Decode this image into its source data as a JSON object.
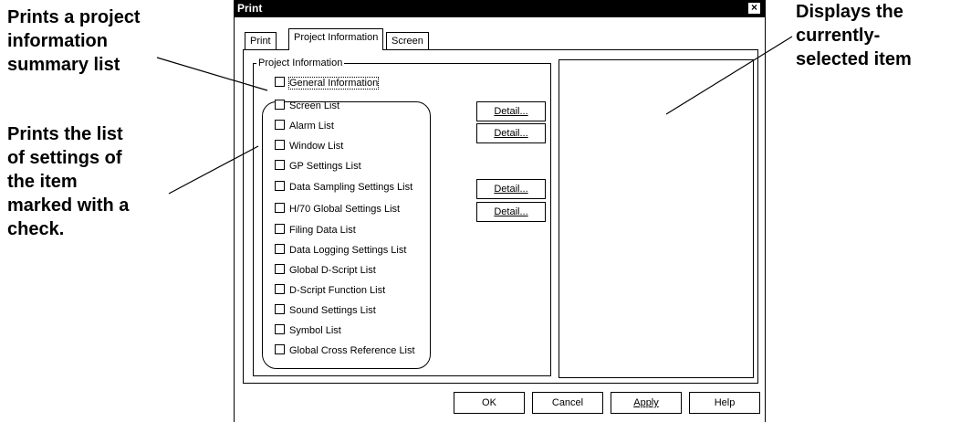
{
  "callouts": {
    "project_summary": "Prints a project\ninformation\nsummary list",
    "settings_list": "Prints the list\nof settings of\nthe item\nmarked with a\ncheck.",
    "selected_item": "Displays the\ncurrently-\nselected item"
  },
  "dialog": {
    "title": "Print",
    "close_glyph": "×",
    "tabs": [
      "Print",
      "Project Information",
      "Screen"
    ],
    "active_tab": "Project Information",
    "group_title": "Project Information",
    "items": [
      {
        "label": "General Information",
        "checked": false
      },
      {
        "label": "Screen List",
        "checked": false
      },
      {
        "label": "Alarm List",
        "checked": false
      },
      {
        "label": "Window List",
        "checked": false
      },
      {
        "label": "GP Settings List",
        "checked": false
      },
      {
        "label": "Data Sampling Settings List",
        "checked": false
      },
      {
        "label": "H/70 Global Settings List",
        "checked": false
      },
      {
        "label": "Filing Data List",
        "checked": false
      },
      {
        "label": "Data Logging Settings List",
        "checked": false
      },
      {
        "label": "Global D-Script List",
        "checked": false
      },
      {
        "label": "D-Script Function List",
        "checked": false
      },
      {
        "label": "Sound Settings List",
        "checked": false
      },
      {
        "label": "Symbol List",
        "checked": false
      },
      {
        "label": "Global Cross Reference List",
        "checked": false
      }
    ],
    "detail_label": "Detail...",
    "buttons": {
      "ok": "OK",
      "cancel": "Cancel",
      "apply": "Apply",
      "help": "Help"
    }
  }
}
